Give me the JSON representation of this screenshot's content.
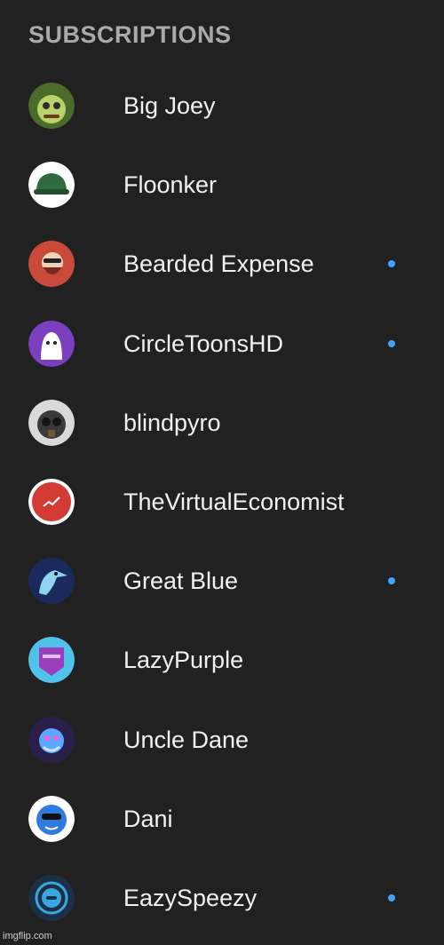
{
  "section": {
    "title": "SUBSCRIPTIONS"
  },
  "subscriptions": [
    {
      "name": "Big Joey",
      "new_content": false,
      "avatar_bg": "#4a6b2a",
      "avatar_fg": "#b7d36a"
    },
    {
      "name": "Floonker",
      "new_content": false,
      "avatar_bg": "#ffffff",
      "avatar_fg": "#2f6b3e"
    },
    {
      "name": "Bearded Expense",
      "new_content": true,
      "avatar_bg": "#c94a3a",
      "avatar_fg": "#f0d2b6"
    },
    {
      "name": "CircleToonsHD",
      "new_content": true,
      "avatar_bg": "#7b3fbf",
      "avatar_fg": "#ffffff"
    },
    {
      "name": "blindpyro",
      "new_content": false,
      "avatar_bg": "#d9d9d9",
      "avatar_fg": "#3a3a3a"
    },
    {
      "name": "TheVirtualEconomist",
      "new_content": false,
      "avatar_bg": "#ffffff",
      "avatar_fg": "#d23b33"
    },
    {
      "name": "Great Blue",
      "new_content": true,
      "avatar_bg": "#1b2a5c",
      "avatar_fg": "#8fd3f0"
    },
    {
      "name": "LazyPurple",
      "new_content": false,
      "avatar_bg": "#4fc3e8",
      "avatar_fg": "#9b3fbf"
    },
    {
      "name": "Uncle Dane",
      "new_content": false,
      "avatar_bg": "#2a1f4a",
      "avatar_fg": "#5aa8ff"
    },
    {
      "name": "Dani",
      "new_content": false,
      "avatar_bg": "#ffffff",
      "avatar_fg": "#2f7be0"
    },
    {
      "name": "EazySpeezy",
      "new_content": true,
      "avatar_bg": "#1c2f45",
      "avatar_fg": "#39a8e0"
    }
  ],
  "watermark": "imgflip.com",
  "colors": {
    "background": "#212121",
    "header_text": "#aaaaaa",
    "item_text": "#f1f1f1",
    "new_content_dot": "#3ea6ff"
  }
}
